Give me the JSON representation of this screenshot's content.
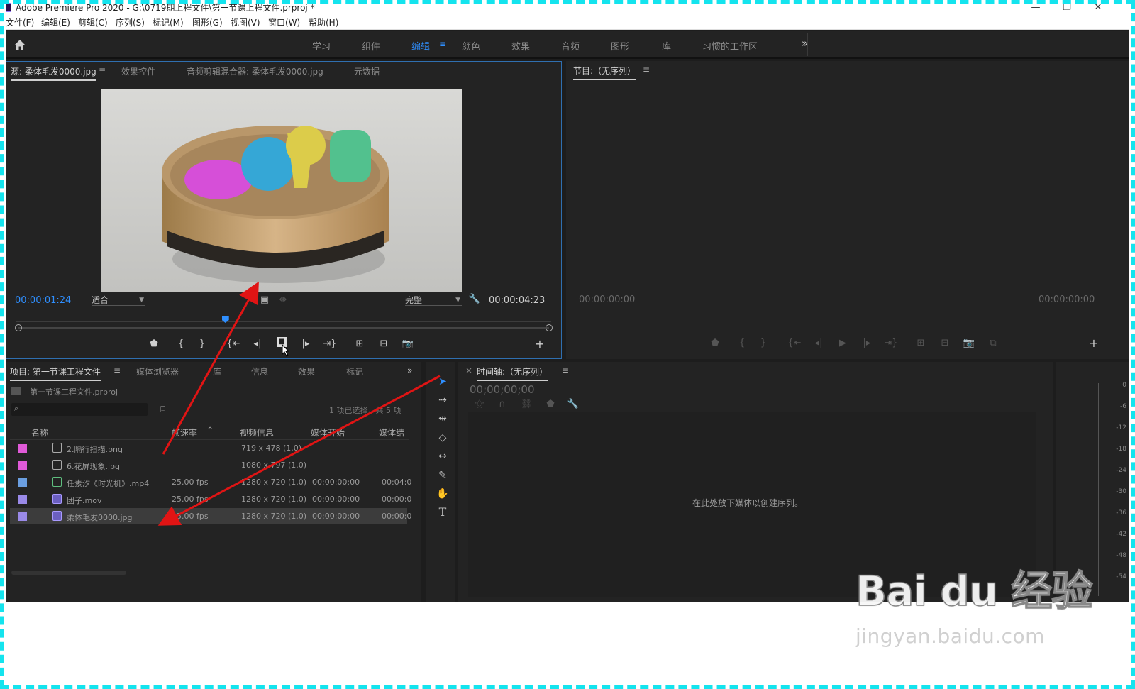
{
  "window": {
    "title": "Adobe Premiere Pro 2020 - G:\\0719期上程文件\\第一节课上程文件.prproj *",
    "minimize": "—",
    "restore": "❐",
    "close": "✕"
  },
  "menu": [
    "文件(F)",
    "编辑(E)",
    "剪辑(C)",
    "序列(S)",
    "标记(M)",
    "图形(G)",
    "视图(V)",
    "窗口(W)",
    "帮助(H)"
  ],
  "workspaces": {
    "items": [
      "学习",
      "组件",
      "编辑",
      "颜色",
      "效果",
      "音频",
      "图形",
      "库",
      "习惯的工作区"
    ],
    "active": "编辑",
    "more": "»"
  },
  "source_panel": {
    "tabs": [
      "源: 柔体毛发0000.jpg",
      "效果控件",
      "音频剪辑混合器: 柔体毛发0000.jpg",
      "元数据"
    ],
    "current_time": "00:00:01:24",
    "zoom": "适合",
    "quality": "完整",
    "duration": "00:00:04:23",
    "playhead_fraction": 0.39
  },
  "program_panel": {
    "title": "节目:（无序列）",
    "current_time": "00:00:00:00",
    "duration": "00:00:00:00"
  },
  "project_panel": {
    "tabs": [
      "项目: 第一节课工程文件",
      "媒体浏览器",
      "库",
      "信息",
      "效果",
      "标记"
    ],
    "project_file": "第一节课工程文件.prproj",
    "search_placeholder": "",
    "selection_info": "1 项已选择，共 5 项",
    "columns": [
      "名称",
      "帧速率",
      "视频信息",
      "媒体开始",
      "媒体结"
    ],
    "rows": [
      {
        "name": "2.隔行扫描.png",
        "fps": "",
        "video": "719 x 478 (1.0)",
        "start": "",
        "end": "",
        "color": "#e05ad8",
        "selected": false
      },
      {
        "name": "6.花屏现象.jpg",
        "fps": "",
        "video": "1080 x 797 (1.0)",
        "start": "",
        "end": "",
        "color": "#e05ad8",
        "selected": false
      },
      {
        "name": "任素汐《时光机》.mp4",
        "fps": "25.00 fps",
        "video": "1280 x 720 (1.0)",
        "start": "00:00:00:00",
        "end": "00:04:0",
        "color": "#6a9ee0",
        "selected": false
      },
      {
        "name": "团子.mov",
        "fps": "25.00 fps",
        "video": "1280 x 720 (1.0)",
        "start": "00:00:00:00",
        "end": "00:00:0",
        "color": "#9a8ae8",
        "selected": false
      },
      {
        "name": "柔体毛发0000.jpg",
        "fps": "25.00 fps",
        "video": "1280 x 720 (1.0)",
        "start": "00:00:00:00",
        "end": "00:00:0",
        "color": "#9a8ae8",
        "selected": true
      }
    ]
  },
  "timeline_panel": {
    "title": "时间轴:（无序列）",
    "timecode": "00;00;00;00",
    "empty_message": "在此处放下媒体以创建序列。"
  },
  "audio_meter": {
    "labels": [
      "0",
      "-6",
      "-12",
      "-18",
      "-24",
      "-30",
      "-36",
      "-42",
      "-48",
      "-54"
    ]
  },
  "watermark": {
    "logo": "Bai du 经验",
    "url": "jingyan.baidu.com"
  },
  "colors": {
    "accent": "#2f8fff",
    "annotation_arrow": "#e01414",
    "frame_border": "#14e4ee"
  }
}
